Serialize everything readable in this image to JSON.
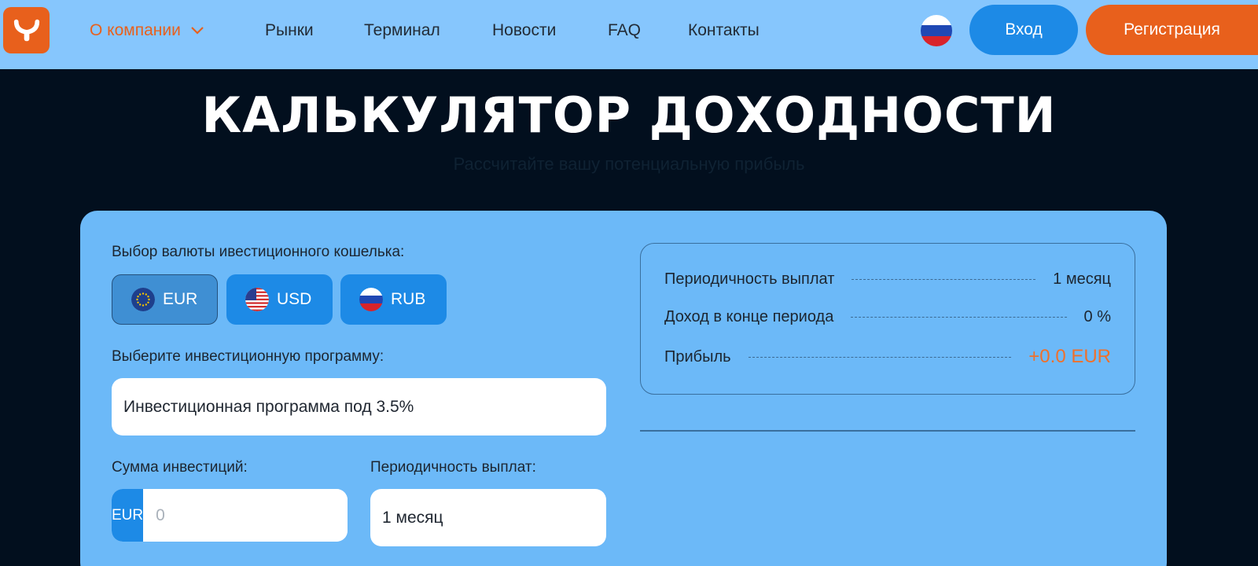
{
  "header": {
    "nav": [
      {
        "label": "О компании",
        "active": true,
        "has_dropdown": true
      },
      {
        "label": "Рынки"
      },
      {
        "label": "Терминал"
      },
      {
        "label": "Новости"
      },
      {
        "label": "FAQ"
      },
      {
        "label": "Контакты"
      }
    ],
    "language_icon": "flag-ru-icon",
    "login_label": "Вход",
    "register_label": "Регистрация"
  },
  "hero": {
    "title": "КАЛЬКУЛЯТОР ДОХОДНОСТИ",
    "subtitle": "Рассчитайте вашу потенциальную прибыль"
  },
  "calculator": {
    "currency_label": "Выбор валюты ивестиционного кошелька:",
    "currencies": [
      {
        "code": "EUR",
        "icon": "flag-eu-icon",
        "selected": true
      },
      {
        "code": "USD",
        "icon": "flag-us-icon",
        "selected": false
      },
      {
        "code": "RUB",
        "icon": "flag-ru-icon",
        "selected": false
      }
    ],
    "program_label": "Выберите инвестиционную программу:",
    "program_value": "Инвестиционная программа под 3.5%",
    "amount_label": "Сумма инвестиций:",
    "amount_currency": "EUR",
    "amount_placeholder": "0",
    "period_label": "Периодичность выплат:",
    "period_value": "1 месяц"
  },
  "results": {
    "rows": [
      {
        "label": "Периодичность выплат",
        "value": "1 месяц"
      },
      {
        "label": "Доход в конце периода",
        "value": "0 %"
      },
      {
        "label": "Прибыль",
        "value": "+0.0 EUR"
      }
    ]
  },
  "colors": {
    "header_bg": "#86c6fd",
    "page_bg": "#020f1e",
    "panel_bg": "#6cb9f8",
    "accent_orange": "#e8601c",
    "accent_blue": "#1d8ae6"
  }
}
